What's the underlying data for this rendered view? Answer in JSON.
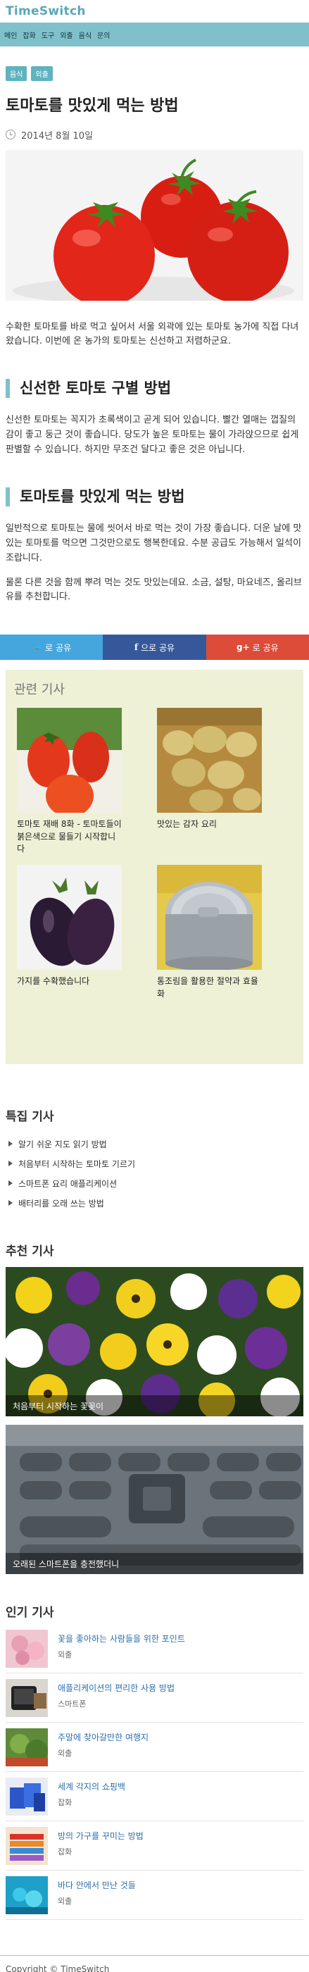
{
  "site": {
    "title": "TimeSwitch"
  },
  "nav": {
    "items": [
      "메인",
      "잡화",
      "도구",
      "외출",
      "음식",
      "문의"
    ]
  },
  "article": {
    "categories": [
      "음식",
      "외출"
    ],
    "title": "토마토를 맛있게 먹는 방법",
    "date": "2014년 8월 10일",
    "lead": "수확한 토마토를 바로 먹고 싶어서 서울 외곽에 있는 토마토 농가에 직접 다녀왔습니다. 이번에 온 농가의 토마토는 신선하고 저렴하군요.",
    "section1_heading": "신선한 토마토 구별 방법",
    "section1_body": "신선한 토마토는 꼭지가 초록색이고 곧게 되어 있습니다. 빨간 열매는 껍질의 감이 좋고 둥근 것이 좋습니다. 당도가 높은 토마토는 물이 가라앉으므로 쉽게 판별할 수 있습니다. 하지만 무조건 달다고 좋은 것은 아닙니다.",
    "section2_heading": "토마토를 맛있게 먹는 방법",
    "section2_body1": "일반적으로 토마토는 물에 씻어서 바로 먹는 것이 가장 좋습니다. 더운 날에 맛있는 토마토를 먹으면 그것만으로도 행복한데요. 수분 공급도 가능해서 일석이조랍니다.",
    "section2_body2": "물론 다른 것을 함께 뿌려 먹는 것도 맛있는데요. 소금, 설탕, 마요네즈, 올리브유를 추천합니다."
  },
  "share": {
    "twitter": "로 공유",
    "facebook": "으로 공유",
    "google": "로 공유"
  },
  "related": {
    "title": "관련 기사",
    "items": [
      {
        "caption": "토마토 재배 8화 - 토마토들이 붉은색으로 물들기 시작합니다"
      },
      {
        "caption": "맛있는 감자 요리"
      },
      {
        "caption": "가지를 수확했습니다"
      },
      {
        "caption": "통조림을 활용한 절약과 효율화"
      }
    ]
  },
  "featured": {
    "title": "특집 기사",
    "items": [
      "알기 쉬운 지도 읽기 방법",
      "처음부터 시작하는 토마토 기르기",
      "스마트폰 요리 애플리케이션",
      "배터리를 오래 쓰는 방법"
    ]
  },
  "recommended": {
    "title": "추천 기사",
    "items": [
      {
        "caption": "처음부터 시작하는 꽃꽂이"
      },
      {
        "caption": "오래된 스마트폰을 충전했더니"
      }
    ]
  },
  "popular": {
    "title": "인기 기사",
    "items": [
      {
        "title": "꽃을 좋아하는 사람들을 위한 포인트",
        "category": "외출"
      },
      {
        "title": "애플리케이션의 편리한 사용 방법",
        "category": "스마트폰"
      },
      {
        "title": "주말에 찾아갈만한 여행지",
        "category": "외출"
      },
      {
        "title": "세계 각지의 쇼핑백",
        "category": "잡화"
      },
      {
        "title": "방의 가구를 꾸미는 방법",
        "category": "잡화"
      },
      {
        "title": "바다 안에서 만난 것들",
        "category": "외출"
      }
    ]
  },
  "footer": {
    "copyright": "Copyright © TimeSwitch"
  },
  "colors": {
    "accent": "#7fc0cb",
    "twitter": "#44a6dd",
    "facebook": "#36589a",
    "google": "#dd4b39",
    "related_bg": "#eef1d6"
  }
}
